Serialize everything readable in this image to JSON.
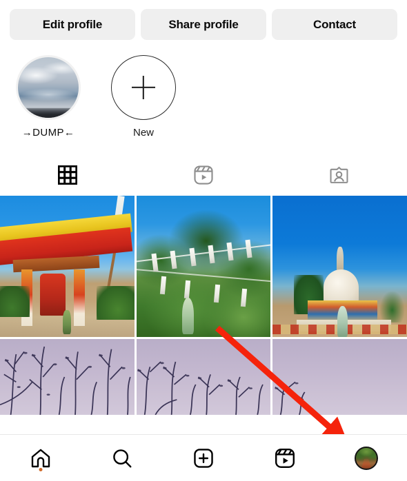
{
  "profile_actions": {
    "edit_label": "Edit profile",
    "share_label": "Share profile",
    "contact_label": "Contact"
  },
  "highlights": [
    {
      "label": "→DUMP←",
      "icon": "story-highlight-cover",
      "type": "cover"
    },
    {
      "label": "New",
      "icon": "plus-icon",
      "type": "new"
    }
  ],
  "content_tabs": [
    {
      "name": "grid",
      "icon": "grid-icon",
      "active": true
    },
    {
      "name": "reels",
      "icon": "reels-icon",
      "active": false
    },
    {
      "name": "tagged",
      "icon": "tagged-person-icon",
      "active": false
    }
  ],
  "grid_posts": [
    {
      "name": "post-buddhist-gate",
      "alt": "Red and yellow Buddhist gate with prayer wheel under blue sky"
    },
    {
      "name": "post-prayer-flags",
      "alt": "Green trees with white prayer flags"
    },
    {
      "name": "post-stupa",
      "alt": "White stupa with colorful painted base against deep blue sky"
    },
    {
      "name": "post-branches-1",
      "alt": "Bare tree branches against lavender dusk sky"
    },
    {
      "name": "post-branches-2",
      "alt": "Bare tree branches against lavender dusk sky"
    },
    {
      "name": "post-branches-3",
      "alt": "Lavender dusk sky with sparse branches"
    }
  ],
  "bottom_nav": [
    {
      "name": "home",
      "icon": "home-icon",
      "active": true,
      "has_dot": true
    },
    {
      "name": "search",
      "icon": "search-icon",
      "active": false,
      "has_dot": false
    },
    {
      "name": "create",
      "icon": "plus-square-icon",
      "active": false,
      "has_dot": false
    },
    {
      "name": "reels",
      "icon": "reels-icon",
      "active": false,
      "has_dot": false
    },
    {
      "name": "profile",
      "icon": "profile-avatar",
      "active": false,
      "has_dot": false
    }
  ],
  "annotation": {
    "type": "arrow",
    "color": "#F5230B",
    "points_to": "profile-avatar-nav-button"
  },
  "colors": {
    "button_bg": "#efefef",
    "text": "#0a0a0a",
    "inactive_icon": "#8e8e8e",
    "active_icon": "#000000",
    "nav_dot": "#cf6a2a",
    "arrow": "#F5230B"
  }
}
